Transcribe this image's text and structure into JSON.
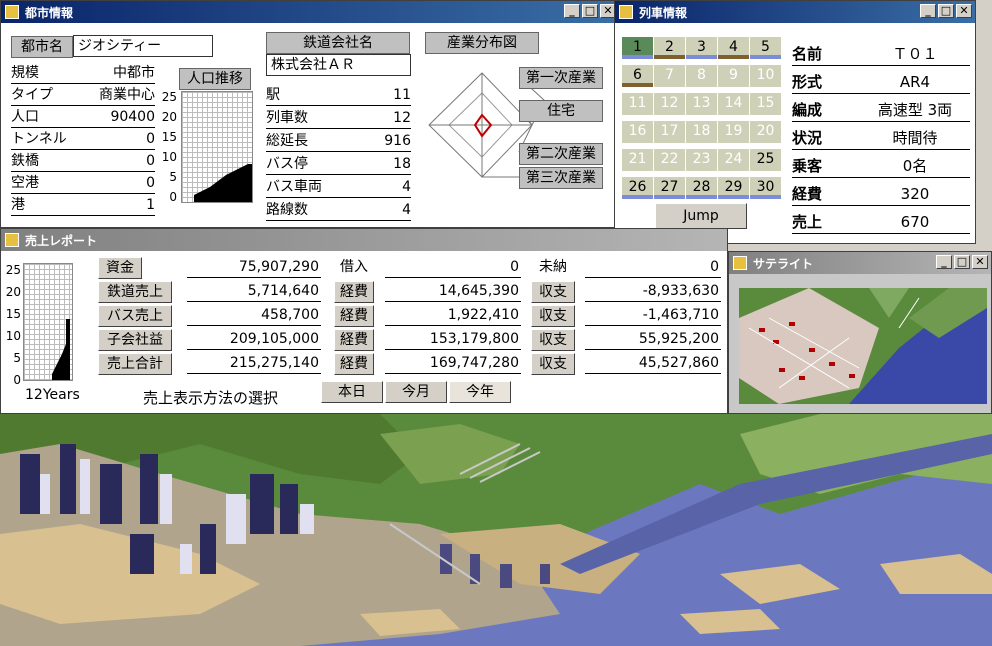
{
  "city_window": {
    "title": "都市情報",
    "city_name_label": "都市名",
    "city_name": "ジオシティー",
    "stats": [
      {
        "label": "規模",
        "value": "中都市"
      },
      {
        "label": "タイプ",
        "value": "商業中心"
      },
      {
        "label": "人口",
        "value": "90400"
      },
      {
        "label": "トンネル",
        "value": "0"
      },
      {
        "label": "鉄橋",
        "value": "0"
      },
      {
        "label": "空港",
        "value": "0"
      },
      {
        "label": "港",
        "value": "1"
      }
    ],
    "pop_chart_title": "人口推移",
    "pop_axis": [
      "25",
      "20",
      "15",
      "10",
      "5",
      "0"
    ],
    "railway_label": "鉄道会社名",
    "railway_name": "株式会社ＡＲ",
    "rail_stats": [
      {
        "label": "駅",
        "value": "11"
      },
      {
        "label": "列車数",
        "value": "12"
      },
      {
        "label": "総延長",
        "value": "916"
      },
      {
        "label": "バス停",
        "value": "18"
      },
      {
        "label": "バス車両",
        "value": "4"
      },
      {
        "label": "路線数",
        "value": "4"
      }
    ],
    "industry_label": "産業分布図",
    "industry_items": [
      "第一次産業",
      "住宅",
      "第二次産業",
      "第三次産業"
    ]
  },
  "train_window": {
    "title": "列車情報",
    "cells": [
      "1",
      "2",
      "3",
      "4",
      "5",
      "6",
      "7",
      "8",
      "9",
      "10",
      "11",
      "12",
      "13",
      "14",
      "15",
      "16",
      "17",
      "18",
      "19",
      "20",
      "21",
      "22",
      "23",
      "24",
      "25",
      "26",
      "27",
      "28",
      "29",
      "30"
    ],
    "jump_label": "Jump",
    "info": [
      {
        "label": "名前",
        "value": "Ｔ０１"
      },
      {
        "label": "形式",
        "value": "AR4"
      },
      {
        "label": "編成",
        "value": "高速型 3両"
      },
      {
        "label": "状況",
        "value": "時間待"
      },
      {
        "label": "乗客",
        "value": "0名"
      },
      {
        "label": "経費",
        "value": "320"
      },
      {
        "label": "売上",
        "value": "670"
      }
    ]
  },
  "sales_window": {
    "title": "売上レポート",
    "axis": [
      "25",
      "20",
      "15",
      "10",
      "5",
      "0"
    ],
    "years_label": "12Years",
    "rows": [
      {
        "label": "資金",
        "value": "75,907,290",
        "mid_label": "借入",
        "mid_value": "0",
        "right_label": "未納",
        "right_value": "0"
      },
      {
        "label": "鉄道売上",
        "value": "5,714,640",
        "mid_label": "経費",
        "mid_value": "14,645,390",
        "right_label": "収支",
        "right_value": "-8,933,630"
      },
      {
        "label": "バス売上",
        "value": "458,700",
        "mid_label": "経費",
        "mid_value": "1,922,410",
        "right_label": "収支",
        "right_value": "-1,463,710"
      },
      {
        "label": "子会社益",
        "value": "209,105,000",
        "mid_label": "経費",
        "mid_value": "153,179,800",
        "right_label": "収支",
        "right_value": "55,925,200"
      },
      {
        "label": "売上合計",
        "value": "215,275,140",
        "mid_label": "経費",
        "mid_value": "169,747,280",
        "right_label": "収支",
        "right_value": "45,527,860"
      }
    ],
    "method_label": "売上表示方法の選択",
    "tabs": [
      "本日",
      "今月",
      "今年"
    ]
  },
  "satellite_window": {
    "title": "サテライト"
  },
  "colors": {
    "titlebar": "#0a246a",
    "cell_bg": "#cfd0b8",
    "water": "#6b78c0",
    "grass": "#5a8a3c"
  }
}
